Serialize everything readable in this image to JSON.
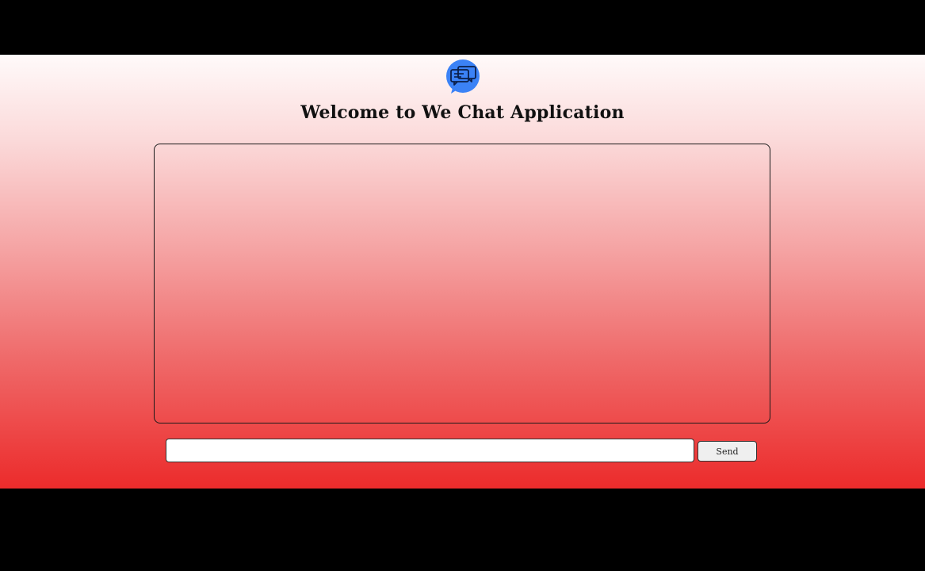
{
  "app": {
    "logo_icon": "chat-bubbles-icon",
    "logo_color": "#3b82f6",
    "title": "Welcome to We Chat Application"
  },
  "chat": {
    "messages": []
  },
  "composer": {
    "input_value": "",
    "input_placeholder": "",
    "send_label": "Send"
  },
  "theme": {
    "gradient_top": "#fffafa",
    "gradient_bottom": "#ec2b2b",
    "frame": "#000000"
  }
}
